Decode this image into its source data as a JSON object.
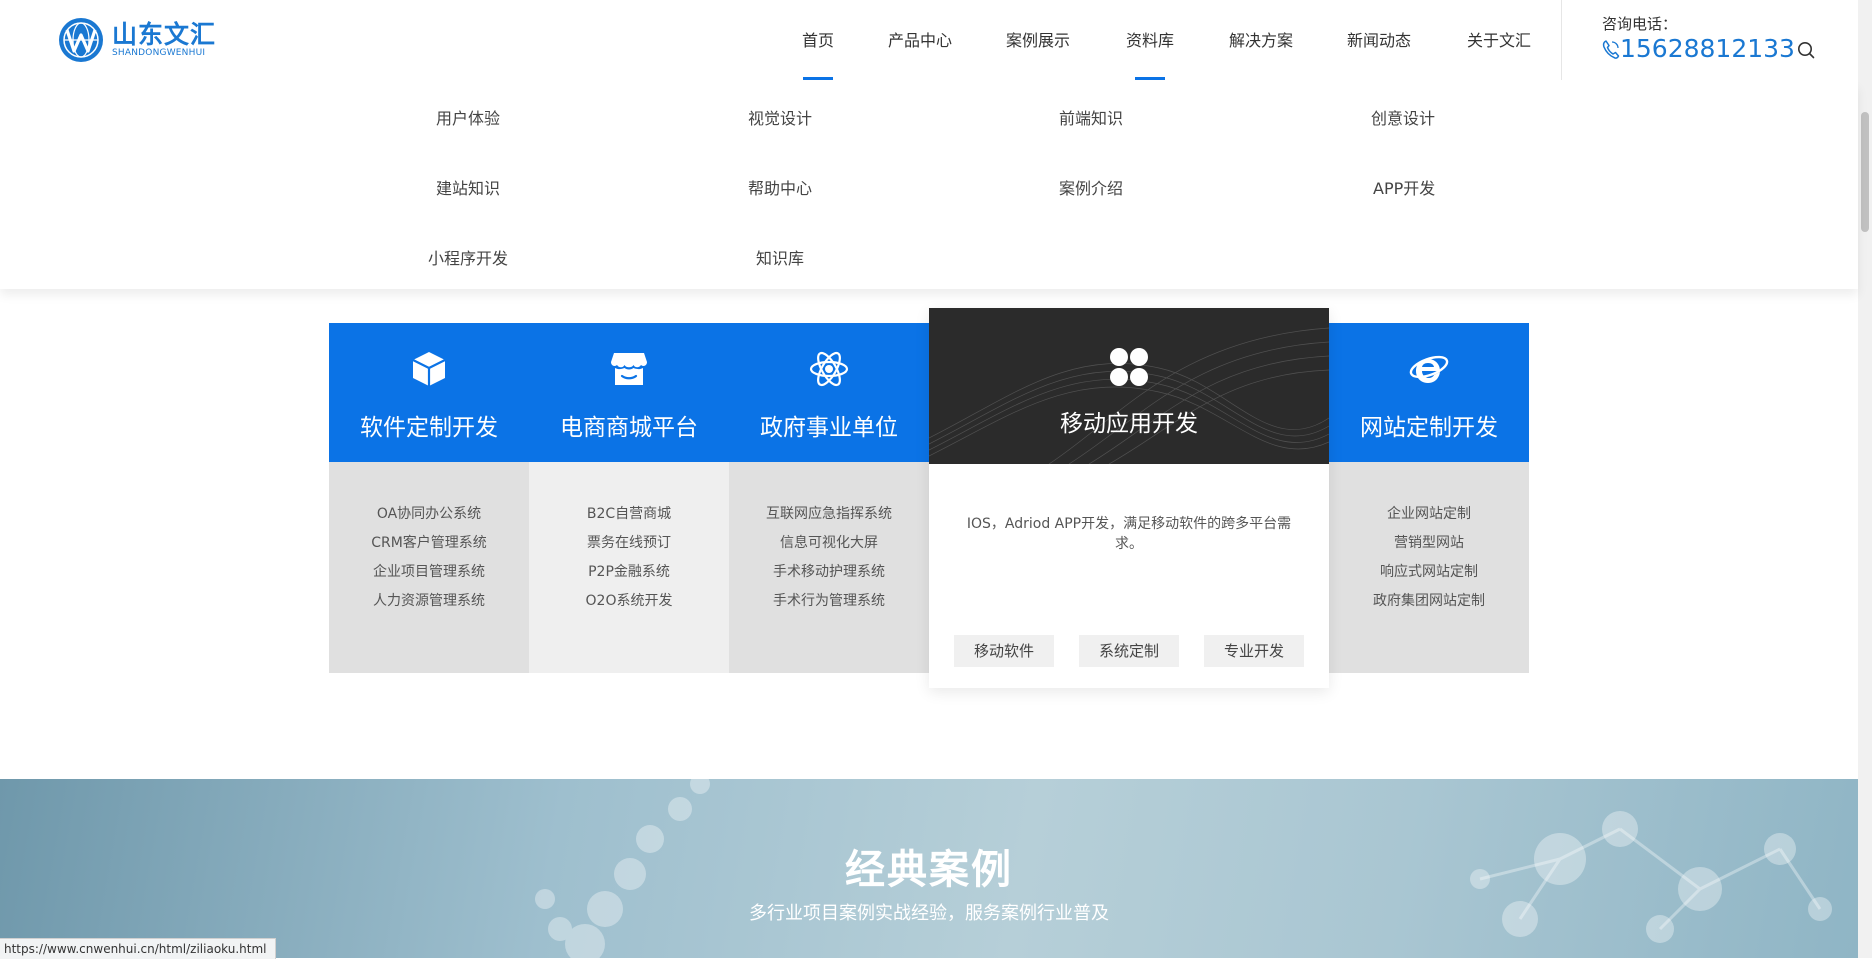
{
  "logo": {
    "cn": "山东文汇",
    "en": "SHANDONGWENHUI"
  },
  "nav": {
    "items": [
      "首页",
      "产品中心",
      "案例展示",
      "资料库",
      "解决方案",
      "新闻动态",
      "关于文汇"
    ],
    "active": [
      "首页",
      "资料库"
    ]
  },
  "contact": {
    "label": "咨询电话：",
    "phone": "15628812133"
  },
  "dropdown": {
    "items": [
      "用户体验",
      "视觉设计",
      "前端知识",
      "创意设计",
      "建站知识",
      "帮助中心",
      "案例介绍",
      "APP开发",
      "小程序开发",
      "知识库"
    ]
  },
  "services": [
    {
      "title": "软件定制开发",
      "icon": "cube-icon",
      "items": [
        "OA协同办公系统",
        "CRM客户管理系统",
        "企业项目管理系统",
        "人力资源管理系统"
      ]
    },
    {
      "title": "电商商城平台",
      "icon": "store-icon",
      "items": [
        "B2C自营商城",
        "票务在线预订",
        "P2P金融系统",
        "O2O系统开发"
      ]
    },
    {
      "title": "政府事业单位",
      "icon": "atom-icon",
      "items": [
        "互联网应急指挥系统",
        "信息可视化大屏",
        "手术移动护理系统",
        "手术行为管理系统"
      ]
    },
    {
      "title": "网站定制开发",
      "icon": "ie-icon",
      "items": [
        "企业网站定制",
        "营销型网站",
        "响应式网站定制",
        "政府集团网站定制"
      ]
    }
  ],
  "feature": {
    "title": "移动应用开发",
    "icon": "apps-grid-icon",
    "desc": "IOS，Adriod APP开发，满足移动软件的跨多平台需求。",
    "tags": [
      "移动软件",
      "系统定制",
      "专业开发"
    ]
  },
  "cases": {
    "title": "经典案例",
    "subtitle": "多行业项目案例实战经验，服务案例行业普及"
  },
  "status_url": "https://www.cnwenhui.cn/html/ziliaoku.html",
  "colors": {
    "brand_blue": "#0b73e6",
    "logo_blue": "#1a78d2",
    "dark_panel": "#2b2b2b"
  }
}
